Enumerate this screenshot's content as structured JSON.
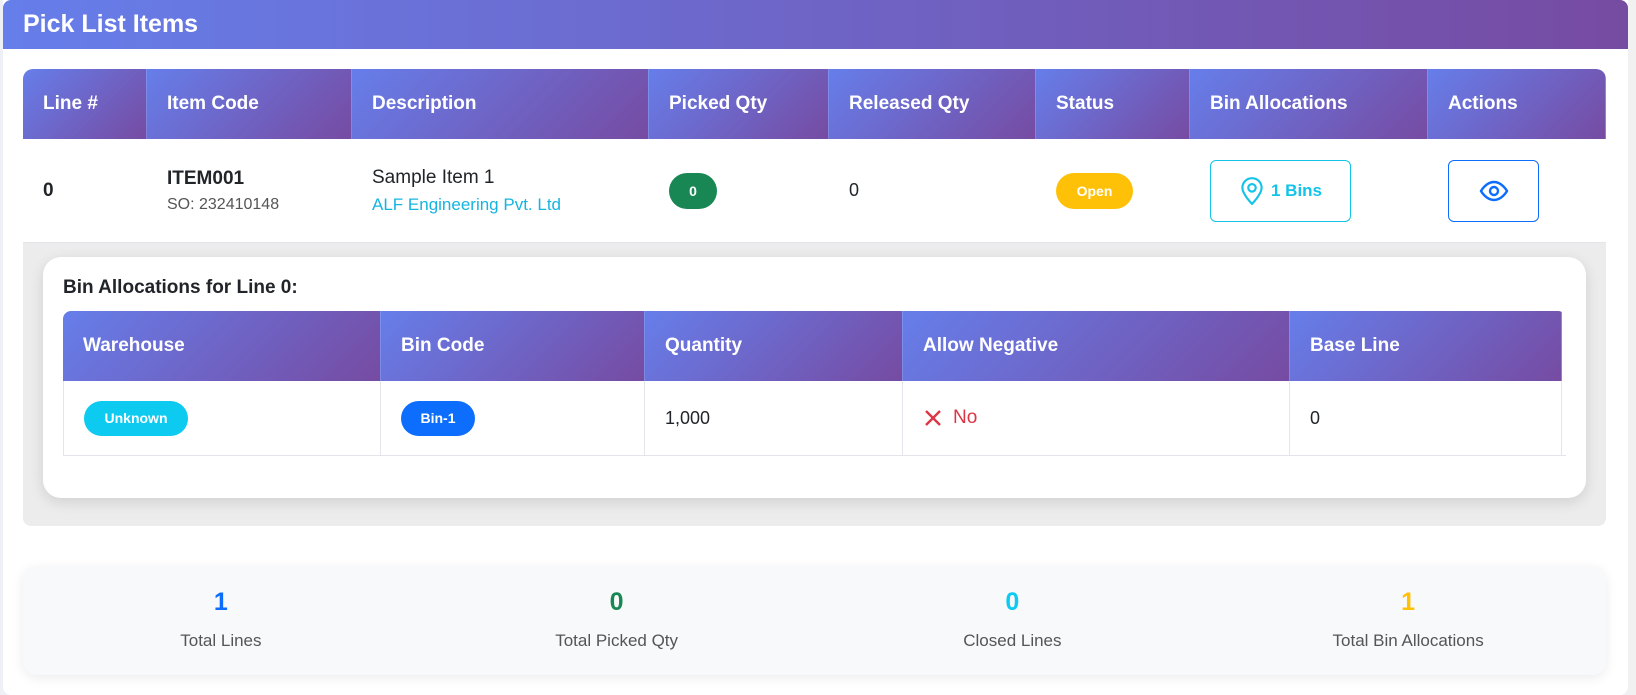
{
  "header": {
    "title": "Pick List Items"
  },
  "table": {
    "columns": [
      "Line #",
      "Item Code",
      "Description",
      "Picked Qty",
      "Released Qty",
      "Status",
      "Bin Allocations",
      "Actions"
    ],
    "rows": [
      {
        "line": "0",
        "item_code": "ITEM001",
        "so": "SO: 232410148",
        "description": "Sample Item 1",
        "customer": "ALF Engineering Pvt. Ltd",
        "picked_qty": "0",
        "released_qty": "0",
        "status": "Open",
        "bins_label": "1 Bins"
      }
    ]
  },
  "bin_allocations": {
    "title": "Bin Allocations for Line 0:",
    "columns": [
      "Warehouse",
      "Bin Code",
      "Quantity",
      "Allow Negative",
      "Base Line"
    ],
    "rows": [
      {
        "warehouse": "Unknown",
        "bin_code": "Bin-1",
        "quantity": "1,000",
        "allow_negative": "No",
        "base_line": "0"
      }
    ]
  },
  "summary": [
    {
      "value": "1",
      "label": "Total Lines",
      "color": "#0d6efd"
    },
    {
      "value": "0",
      "label": "Total Picked Qty",
      "color": "#198754"
    },
    {
      "value": "0",
      "label": "Closed Lines",
      "color": "#0dcaf0"
    },
    {
      "value": "1",
      "label": "Total Bin Allocations",
      "color": "#ffc107"
    }
  ],
  "colors": {
    "gradient_start": "#667eea",
    "gradient_end": "#764ba2",
    "success": "#198754",
    "warning": "#ffc107",
    "info": "#0dcaf0",
    "primary": "#0d6efd",
    "danger": "#dc3545"
  },
  "icons": {
    "bins": "map-pin-icon",
    "view": "eye-icon",
    "negative": "x-icon"
  }
}
